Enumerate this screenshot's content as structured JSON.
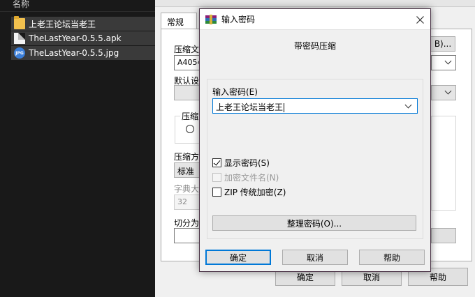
{
  "explorer": {
    "column_header": "名称",
    "files": [
      {
        "name": "上老王论坛当老王",
        "icon": "folder-icon"
      },
      {
        "name": "TheLastYear-0.5.5.apk",
        "icon": "document-icon"
      },
      {
        "name": "TheLastYear-0.5.5.jpg",
        "icon": "jpg-image-icon"
      }
    ]
  },
  "archive_dialog": {
    "tab_general": "常规",
    "archive_name_label": "压缩文",
    "archive_name_value": "A4054",
    "browse_button": "B)...",
    "profile_label": "默认设",
    "format_group_label": "压缩文",
    "method_label": "压缩方",
    "method_value": "标准",
    "dict_label": "字典大",
    "dict_value": "32",
    "split_label": "切分为",
    "ok_button": "确定",
    "cancel_button": "取消",
    "help_button": "帮助"
  },
  "password_dialog": {
    "title": "输入密码",
    "heading": "带密码压缩",
    "password_label": "输入密码(E)",
    "password_value": "上老王论坛当老王",
    "show_password": {
      "label": "显示密码(S)",
      "checked": true,
      "enabled": true
    },
    "encrypt_filenames": {
      "label": "加密文件名(N)",
      "checked": false,
      "enabled": false
    },
    "zip_legacy": {
      "label": "ZIP 传统加密(Z)",
      "checked": false,
      "enabled": true
    },
    "organize_button": "整理密码(O)...",
    "ok_button": "确定",
    "cancel_button": "取消",
    "help_button": "帮助"
  },
  "colors": {
    "accent": "#0078d7",
    "modal_border": "#4a3346",
    "dark_background": "#191919"
  }
}
